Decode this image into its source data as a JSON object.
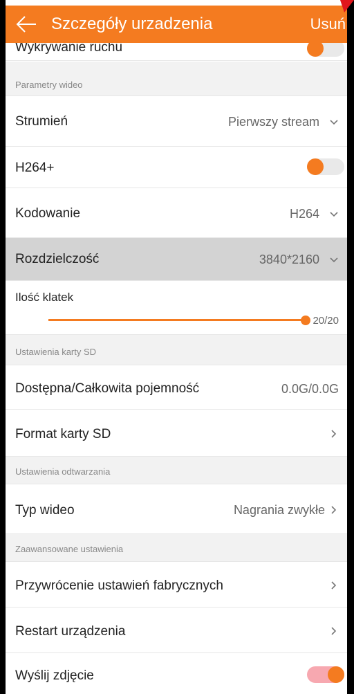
{
  "header": {
    "title": "Szczegóły urzadzenia",
    "action": "Usuń",
    "color": "#f47b20"
  },
  "motion": {
    "label": "Wykrywanie ruchu",
    "enabled": false
  },
  "video_section": {
    "title": "Parametry wideo",
    "stream": {
      "label": "Strumień",
      "value": "Pierwszy stream"
    },
    "h264plus": {
      "label": "H264+",
      "enabled": false
    },
    "encoding": {
      "label": "Kodowanie",
      "value": "H264"
    },
    "resolution": {
      "label": "Rozdzielczość",
      "value": "3840*2160"
    },
    "framerate": {
      "label": "Ilość klatek",
      "value_text": "20/20",
      "value": 20,
      "max": 20
    }
  },
  "sd_section": {
    "title": "Ustawienia karty SD",
    "capacity": {
      "label": "Dostępna/Całkowita pojemność",
      "value": "0.0G/0.0G"
    },
    "format": {
      "label": "Format karty SD"
    }
  },
  "playback_section": {
    "title": "Ustawienia odtwarzania",
    "video_type": {
      "label": "Typ wideo",
      "value": "Nagrania zwykłe"
    }
  },
  "advanced_section": {
    "title": "Zaawansowane ustawienia",
    "factory_reset": {
      "label": "Przywrócenie ustawień fabrycznych"
    },
    "restart": {
      "label": "Restart urządzenia"
    },
    "send_photo": {
      "label": "Wyślij zdjęcie",
      "enabled": true
    }
  },
  "colors": {
    "accent": "#f47b20",
    "toggle_off_track": "#e9e9e9",
    "toggle_on_track": "#f7a8b0"
  }
}
